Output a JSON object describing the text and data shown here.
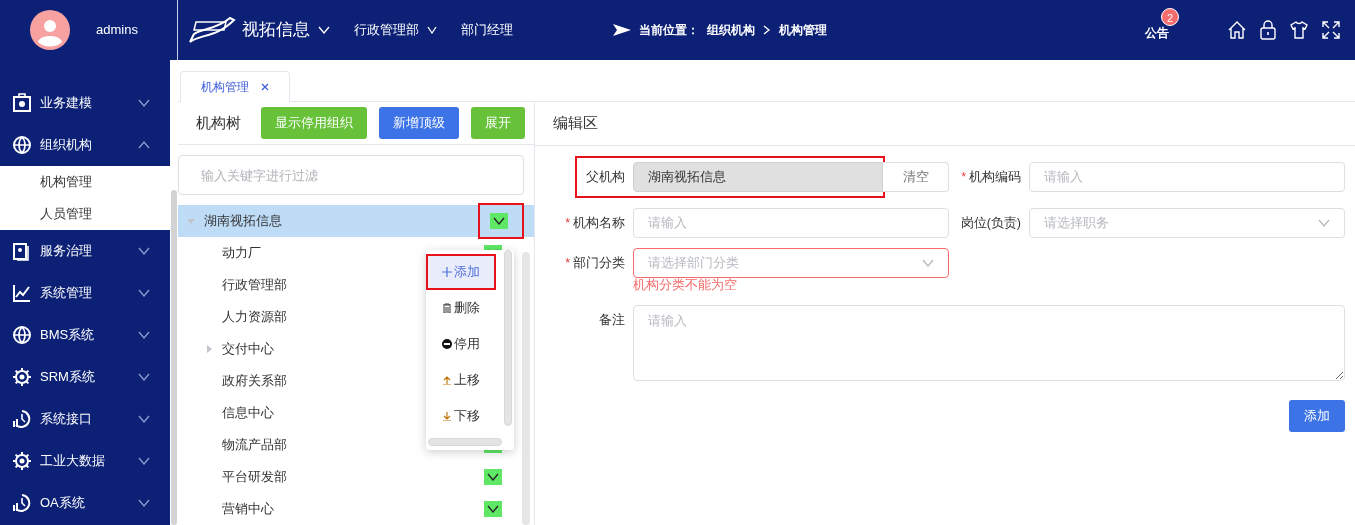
{
  "user": {
    "name": "admins"
  },
  "header": {
    "company": "视拓信息",
    "department": "行政管理部",
    "role": "部门经理",
    "breadcrumb_label": "当前位置：",
    "breadcrumb": [
      "组织机构",
      "机构管理"
    ],
    "notice": "公告",
    "notice_count": "2"
  },
  "sidebar": {
    "items": [
      {
        "label": "业务建模",
        "expanded": false
      },
      {
        "label": "组织机构",
        "expanded": true,
        "children": [
          {
            "label": "机构管理"
          },
          {
            "label": "人员管理"
          }
        ]
      },
      {
        "label": "服务治理",
        "expanded": false
      },
      {
        "label": "系统管理",
        "expanded": false
      },
      {
        "label": "BMS系统",
        "expanded": false
      },
      {
        "label": "SRM系统",
        "expanded": false
      },
      {
        "label": "系统接口",
        "expanded": false
      },
      {
        "label": "工业大数据",
        "expanded": false
      },
      {
        "label": "OA系统",
        "expanded": false
      }
    ]
  },
  "tabs": [
    {
      "label": "机构管理",
      "selected": true
    }
  ],
  "tree_panel": {
    "title": "机构树",
    "buttons": [
      {
        "label": "显示停用组织",
        "kind": "success"
      },
      {
        "label": "新增顶级",
        "kind": "primary"
      },
      {
        "label": "展开",
        "kind": "success"
      }
    ],
    "filter": {
      "placeholder": "输入关键字进行过滤"
    },
    "nodes": [
      {
        "label": "湖南视拓信息",
        "selected": true,
        "expanded": true,
        "toggle_highlighted": true,
        "children": [
          {
            "label": "动力厂",
            "selected": false
          },
          {
            "label": "行政管理部",
            "selected": false
          },
          {
            "label": "人力资源部",
            "selected": false
          },
          {
            "label": "交付中心",
            "selected": false,
            "expanded": false
          },
          {
            "label": "政府关系部",
            "selected": false
          },
          {
            "label": "信息中心",
            "selected": false
          },
          {
            "label": "物流产品部",
            "selected": false
          },
          {
            "label": "平台研发部",
            "selected": false
          },
          {
            "label": "营销中心",
            "selected": false
          }
        ]
      }
    ],
    "menu": [
      {
        "label": "添加",
        "kind": "add",
        "selected": true,
        "highlighted": true
      },
      {
        "label": "删除",
        "kind": "delete",
        "selected": false,
        "highlighted": false
      },
      {
        "label": "停用",
        "kind": "disable",
        "selected": false,
        "highlighted": false
      },
      {
        "label": "上移",
        "kind": "up",
        "selected": false,
        "highlighted": false
      },
      {
        "label": "下移",
        "kind": "down",
        "selected": false,
        "highlighted": false
      }
    ]
  },
  "edit_panel": {
    "title": "编辑区",
    "parent": {
      "label": "父机构",
      "value": "湖南视拓信息",
      "clear": "清空",
      "highlighted": true
    },
    "code": {
      "label": "机构编码",
      "required_mark": "*",
      "placeholder": "请输入"
    },
    "name": {
      "label": "机构名称",
      "required_mark": "*",
      "placeholder": "请输入"
    },
    "position": {
      "label": "岗位(负责)",
      "placeholder": "请选择职务"
    },
    "category": {
      "label": "部门分类",
      "required_mark": "*",
      "placeholder": "请选择部门分类",
      "error": "机构分类不能为空"
    },
    "remark": {
      "label": "备注",
      "placeholder": "请输入"
    },
    "submit": "添加"
  }
}
